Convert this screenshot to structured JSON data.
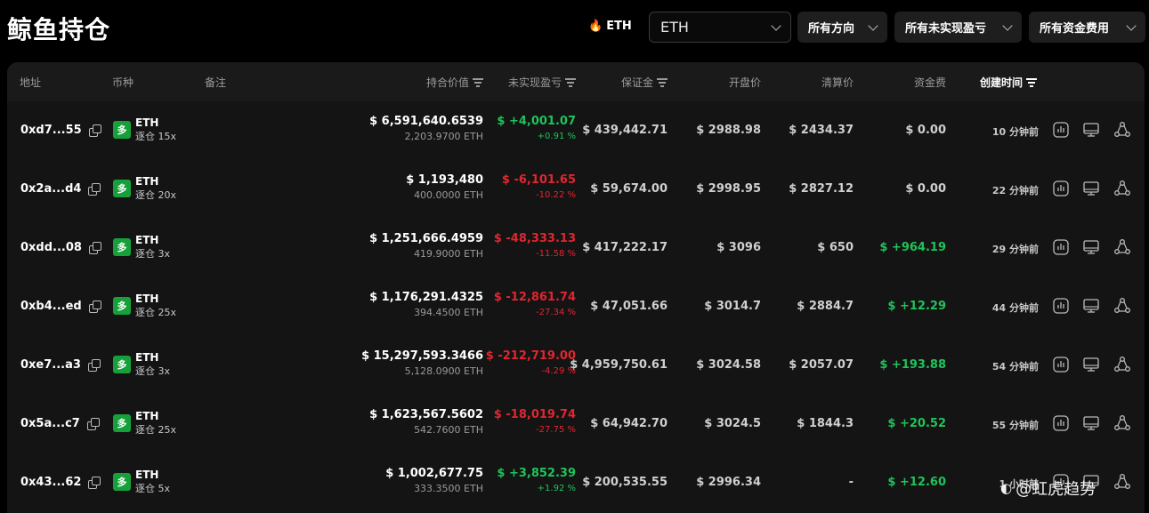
{
  "header": {
    "title": "鲸鱼持仓",
    "hot_label": "ETH",
    "asset_select": "ETH",
    "direction_select": "所有方向",
    "pnl_select": "所有未实现盈亏",
    "funding_select": "所有资金费用"
  },
  "columns": {
    "address": "地址",
    "coin": "币种",
    "note": "备注",
    "position_value": "持合价值",
    "unrealized_pnl": "未实现盈亏",
    "margin": "保证金",
    "open_price": "开盘价",
    "liq_price": "清算价",
    "funding_fee": "资金费",
    "created_time": "创建时间"
  },
  "rows": [
    {
      "address": "0xd7...55",
      "side": "多",
      "coin": "ETH",
      "leverage": "逐仓 15x",
      "value": "$ 6,591,640.6539",
      "size": "2,203.9700 ETH",
      "pnl": "$ +4,001.07",
      "pnl_pct": "+0.91 %",
      "pnl_sign": "pos",
      "margin": "$ 439,442.71",
      "open": "$ 2988.98",
      "liq": "$ 2434.37",
      "fee": "$ 0.00",
      "fee_sign": "neutral",
      "created": "10 分钟前"
    },
    {
      "address": "0x2a...d4",
      "side": "多",
      "coin": "ETH",
      "leverage": "逐仓 20x",
      "value": "$ 1,193,480",
      "size": "400.0000 ETH",
      "pnl": "$ -6,101.65",
      "pnl_pct": "-10.22 %",
      "pnl_sign": "neg",
      "margin": "$ 59,674.00",
      "open": "$ 2998.95",
      "liq": "$ 2827.12",
      "fee": "$ 0.00",
      "fee_sign": "neutral",
      "created": "22 分钟前"
    },
    {
      "address": "0xdd...08",
      "side": "多",
      "coin": "ETH",
      "leverage": "逐仓 3x",
      "value": "$ 1,251,666.4959",
      "size": "419.9000 ETH",
      "pnl": "$ -48,333.13",
      "pnl_pct": "-11.58 %",
      "pnl_sign": "neg",
      "margin": "$ 417,222.17",
      "open": "$ 3096",
      "liq": "$ 650",
      "fee": "$ +964.19",
      "fee_sign": "pos",
      "created": "29 分钟前"
    },
    {
      "address": "0xb4...ed",
      "side": "多",
      "coin": "ETH",
      "leverage": "逐仓 25x",
      "value": "$ 1,176,291.4325",
      "size": "394.4500 ETH",
      "pnl": "$ -12,861.74",
      "pnl_pct": "-27.34 %",
      "pnl_sign": "neg",
      "margin": "$ 47,051.66",
      "open": "$ 3014.7",
      "liq": "$ 2884.7",
      "fee": "$ +12.29",
      "fee_sign": "pos",
      "created": "44 分钟前"
    },
    {
      "address": "0xe7...a3",
      "side": "多",
      "coin": "ETH",
      "leverage": "逐仓 3x",
      "value": "$ 15,297,593.3466",
      "size": "5,128.0900 ETH",
      "pnl": "$ -212,719.00",
      "pnl_pct": "-4.29 %",
      "pnl_sign": "neg",
      "margin": "$ 4,959,750.61",
      "open": "$ 3024.58",
      "liq": "$ 2057.07",
      "fee": "$ +193.88",
      "fee_sign": "pos",
      "created": "54 分钟前"
    },
    {
      "address": "0x5a...c7",
      "side": "多",
      "coin": "ETH",
      "leverage": "逐仓 25x",
      "value": "$ 1,623,567.5602",
      "size": "542.7600 ETH",
      "pnl": "$ -18,019.74",
      "pnl_pct": "-27.75 %",
      "pnl_sign": "neg",
      "margin": "$ 64,942.70",
      "open": "$ 3024.5",
      "liq": "$ 1844.3",
      "fee": "$ +20.52",
      "fee_sign": "pos",
      "created": "55 分钟前"
    },
    {
      "address": "0x43...62",
      "side": "多",
      "coin": "ETH",
      "leverage": "逐仓 5x",
      "value": "$ 1,002,677.75",
      "size": "333.3500 ETH",
      "pnl": "$ +3,852.39",
      "pnl_pct": "+1.92 %",
      "pnl_sign": "pos",
      "margin": "$ 200,535.55",
      "open": "$ 2996.34",
      "liq": "-",
      "fee": "$ +12.60",
      "fee_sign": "pos",
      "created": "1 小时前"
    }
  ],
  "watermark": "@虹虎趋势",
  "colors": {
    "positive": "#1fc35a",
    "negative": "#e0262f",
    "badge": "#17a03a",
    "background": "#000000",
    "panel": "#141414"
  },
  "icons": [
    "fire-icon",
    "chevron-down-icon",
    "sort-icon",
    "copy-icon",
    "chart-icon",
    "monitor-icon",
    "share-icon"
  ]
}
